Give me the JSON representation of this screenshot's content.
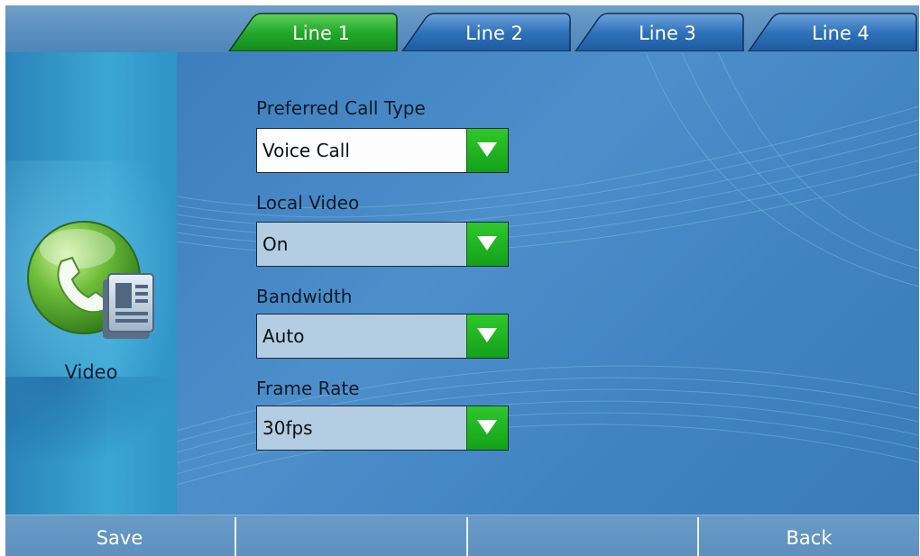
{
  "tabs": [
    {
      "label": "Line 1",
      "active": true
    },
    {
      "label": "Line 2",
      "active": false
    },
    {
      "label": "Line 3",
      "active": false
    },
    {
      "label": "Line 4",
      "active": false
    }
  ],
  "category": {
    "label": "Video",
    "icon": "video-phone-icon"
  },
  "fields": [
    {
      "label": "Preferred Call Type",
      "value": "Voice Call"
    },
    {
      "label": "Local Video",
      "value": "On"
    },
    {
      "label": "Bandwidth",
      "value": "Auto"
    },
    {
      "label": "Frame Rate",
      "value": "30fps"
    }
  ],
  "softkeys": [
    "Save",
    "",
    "",
    "Back"
  ],
  "colors": {
    "active_tab": "#23a92a",
    "inactive_tab": "#2163ad",
    "dropdown_arrow": "#1fb522",
    "background": "#3f83c1"
  }
}
